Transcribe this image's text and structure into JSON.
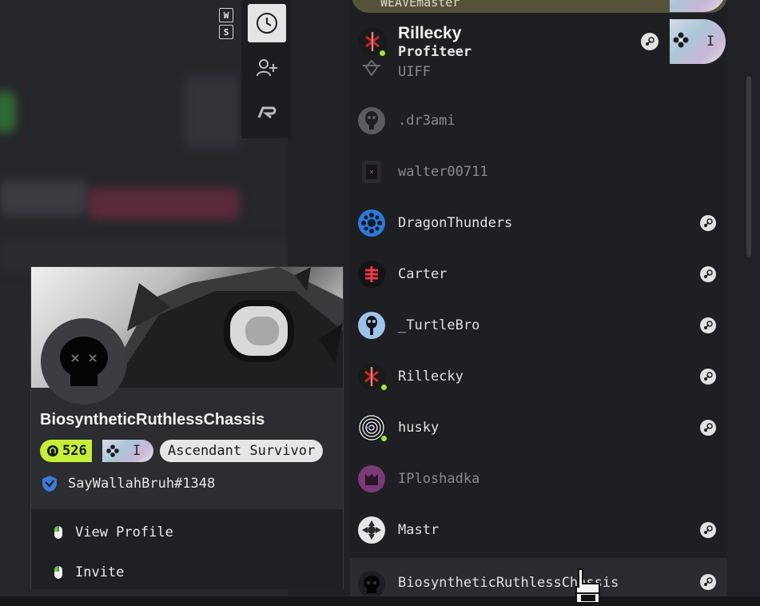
{
  "key_hints": [
    "W",
    "S"
  ],
  "toolbar": {
    "items": [
      {
        "name": "history",
        "icon": "clock-icon",
        "active": true
      },
      {
        "name": "add-friend",
        "icon": "add-user-icon",
        "active": false
      },
      {
        "name": "rank",
        "icon": "r-logo-icon",
        "active": false
      }
    ]
  },
  "top_user": {
    "cut_name": "WEAVEmaster",
    "name": "Rillecky",
    "title": "Profiteer",
    "badge_level": "I"
  },
  "friends": [
    {
      "name": "UIFF",
      "status": "offline",
      "steam": false
    },
    {
      "name": ".dr3ami",
      "status": "offline",
      "steam": false
    },
    {
      "name": "walter00711",
      "status": "offline",
      "steam": false
    },
    {
      "name": "DragonThunders",
      "status": "online",
      "steam": true
    },
    {
      "name": "Carter",
      "status": "online",
      "steam": true
    },
    {
      "name": "_TurtleBro",
      "status": "online",
      "steam": true
    },
    {
      "name": "Rillecky",
      "status": "online",
      "steam": true,
      "dot": true
    },
    {
      "name": "husky",
      "status": "online",
      "steam": true,
      "dot": true
    },
    {
      "name": "IPloshadka",
      "status": "offline",
      "steam": false
    },
    {
      "name": "Mastr",
      "status": "online",
      "steam": true
    },
    {
      "name": "BiosyntheticRuthlessChassis",
      "status": "online",
      "steam": true,
      "selected": true
    }
  ],
  "profile_card": {
    "name": "BiosyntheticRuthlessChassis",
    "level": "526",
    "badge_level": "I",
    "rank": "Ascendant Survivor",
    "tag": "SayWallahBruh#1348",
    "menu": [
      {
        "label": "View Profile"
      },
      {
        "label": "Invite"
      }
    ]
  },
  "colors": {
    "accent": "#c4f03a",
    "online": "#9fe33c",
    "panel": "#1e1f22"
  }
}
